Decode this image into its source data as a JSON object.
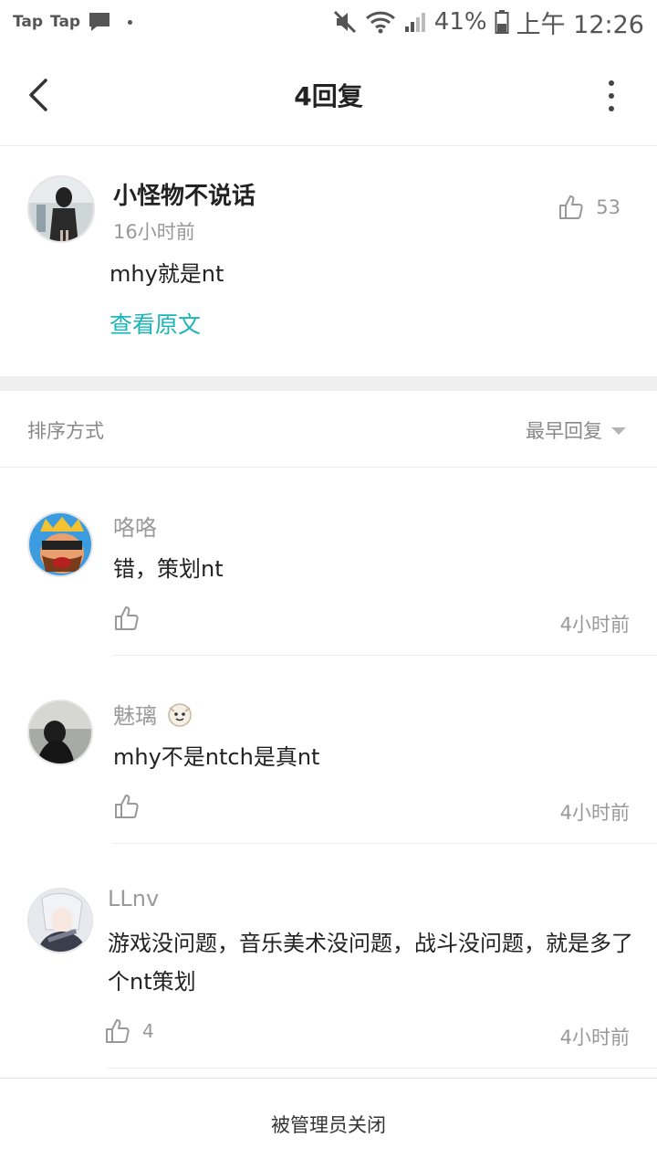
{
  "status_bar": {
    "app_label_1": "Tap",
    "app_label_2": "Tap",
    "battery": "41%",
    "time": "上午 12:26",
    "icons": [
      "message-icon",
      "mute-icon",
      "wifi-icon",
      "signal-icon",
      "battery-icon"
    ]
  },
  "header": {
    "title": "4回复"
  },
  "post": {
    "author": "小怪物不说话",
    "time": "16小时前",
    "content": "mhy就是nt",
    "likes": "53",
    "view_original": "查看原文"
  },
  "sort": {
    "label": "排序方式",
    "selected": "最早回复"
  },
  "replies": [
    {
      "name": "咯咯",
      "text": "错，策划nt",
      "time": "4小时前",
      "likes": ""
    },
    {
      "name": "魅璃",
      "text": "mhy不是ntch是真nt",
      "time": "4小时前",
      "likes": ""
    },
    {
      "name": "LLnv",
      "text": "游戏没问题，音乐美术没问题，战斗没问题，就是多了个nt策划",
      "time": "4小时前",
      "likes": "4"
    }
  ],
  "footer": {
    "status": "被管理员关闭"
  },
  "colors": {
    "accent": "#19b5b8",
    "muted": "#999999",
    "divider": "#ececec"
  }
}
